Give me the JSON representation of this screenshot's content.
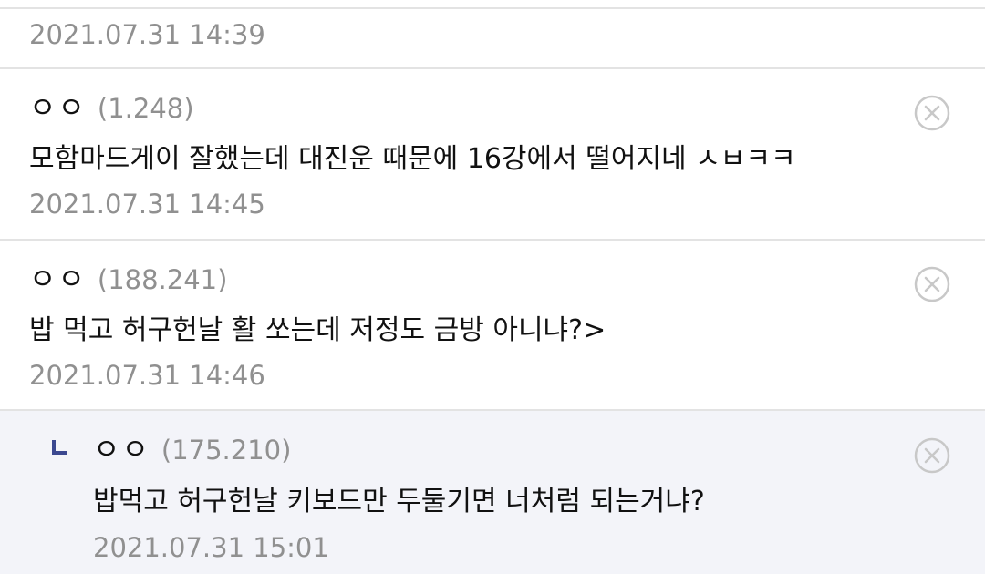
{
  "comments": [
    {
      "date": "2021.07.31 14:39"
    },
    {
      "author": "ㅇㅇ",
      "ip": "(1.248)",
      "text": "모함마드게이 잘했는데 대진운 때문에 16강에서 떨어지네 ㅅㅂㅋㅋ",
      "date": "2021.07.31 14:45",
      "delete_icon": "close-circle-icon"
    },
    {
      "author": "ㅇㅇ",
      "ip": "(188.241)",
      "text": "밥 먹고 허구헌날 활 쏘는데 저정도 금방 아니냐?>",
      "date": "2021.07.31 14:46",
      "delete_icon": "close-circle-icon"
    },
    {
      "author": "ㅇㅇ",
      "ip": "(175.210)",
      "text": "밥먹고 허구헌날 키보드만 두둘기면 너처럼 되는거냐?",
      "date": "2021.07.31 15:01",
      "delete_icon": "close-circle-icon",
      "is_reply": true,
      "reply_icon": "reply-arrow-icon"
    }
  ],
  "colors": {
    "divider": "#e3e3e3",
    "reply_background": "#f3f4f9",
    "reply_marker": "#3b4890",
    "muted_text": "#909090",
    "body_text": "#111111",
    "delete_icon": "#c8c8c8"
  }
}
